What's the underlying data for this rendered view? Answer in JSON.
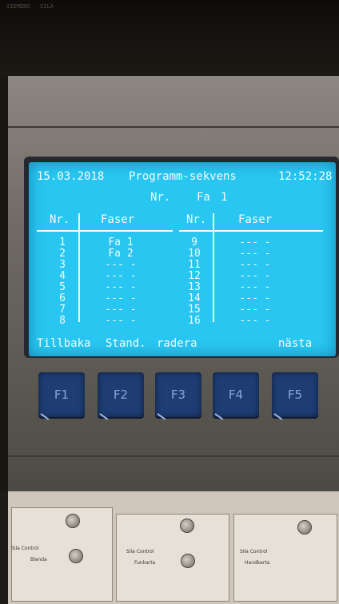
{
  "sticker": {
    "text": "SIEMENS · SILA ·"
  },
  "header": {
    "date": "15.03.2018",
    "title": "Programm-sekvens",
    "time": "12:52:28"
  },
  "subheader": {
    "nr_label": "Nr.",
    "fa_label": "Fa",
    "fa_value": "1"
  },
  "table": {
    "col_nr": "Nr.",
    "col_faser": "Faser",
    "left_nr": [
      "1",
      "2",
      "3",
      "4",
      "5",
      "6",
      "7",
      "8"
    ],
    "left_faser": [
      "Fa 1",
      "Fa 2",
      "--- -",
      "--- -",
      "--- -",
      "--- -",
      "--- -",
      "--- -"
    ],
    "right_nr": [
      "9",
      "10",
      "11",
      "12",
      "13",
      "14",
      "15",
      "16"
    ],
    "right_faser": [
      "--- -",
      "--- -",
      "--- -",
      "--- -",
      "--- -",
      "--- -",
      "--- -",
      "--- -"
    ]
  },
  "softkeys": {
    "tillbaka": "Tillbaka",
    "stand": "Stand.",
    "radera": "radera",
    "nasta": "nästa"
  },
  "function_keys": [
    "F1",
    "F2",
    "F3",
    "F4",
    "F5"
  ],
  "lower_labels": {
    "a": "Sila Control",
    "b": "Blanda",
    "c": "Sila Control",
    "d": "Funkarta",
    "e": "Sila Control",
    "f": "Handkarta"
  },
  "colors": {
    "screen": "#28c6f0",
    "key": "#1e3d73"
  }
}
